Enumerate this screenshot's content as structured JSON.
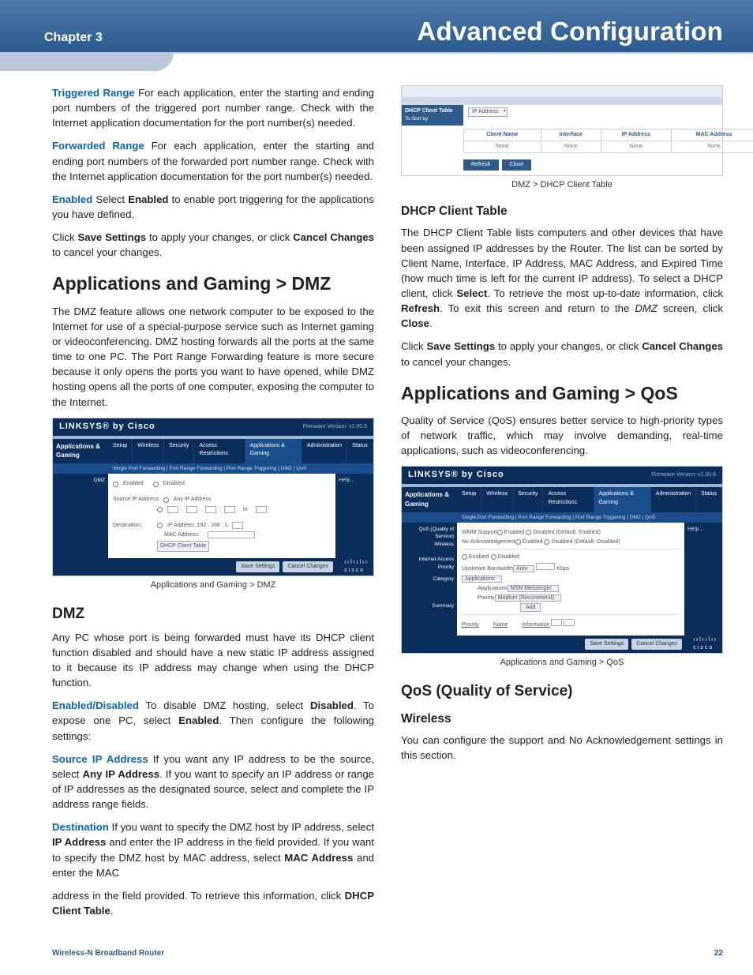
{
  "header": {
    "chapter": "Chapter 3",
    "title": "Advanced Configuration"
  },
  "left": {
    "triggered_label": "Triggered Range",
    "triggered_text": "  For each application, enter the starting and ending port numbers of the triggered port number range. Check with the Internet application documentation for the port number(s) needed.",
    "forwarded_label": "Forwarded Range",
    "forwarded_text": "  For each application, enter the starting and ending port numbers of the forwarded port number range. Check with the Internet application documentation for the port number(s) needed.",
    "enabled_label": "Enabled",
    "enabled_pre": "  Select ",
    "enabled_bold": "Enabled",
    "enabled_post": " to enable port triggering for the applications you have defined.",
    "save1_pre": "Click ",
    "save1_b1": "Save Settings",
    "save1_mid": " to apply your changes, or click ",
    "save1_b2": "Cancel Changes",
    "save1_post": " to cancel your changes.",
    "h_dmz": "Applications and Gaming > DMZ",
    "dmz_para": "The DMZ feature allows one network computer to be exposed to the Internet for use of a special-purpose service such as Internet gaming or videoconferencing. DMZ hosting forwards all the ports at the same time to one PC. The Port Range Forwarding feature is more secure because it only opens the ports you want to have opened, while DMZ hosting opens all the ports of one computer, exposing the computer to the Internet.",
    "fig1_caption": "Applications and Gaming > DMZ",
    "h_dmz2": "DMZ",
    "dmz2_para": "Any PC whose port is being forwarded must have its DHCP client function disabled and should have a new static IP address assigned to it because its IP address may change when using the DHCP function.",
    "ed_label": "Enabled/Disabled",
    "ed_pre": " To disable DMZ hosting, select ",
    "ed_b1": "Disabled",
    "ed_mid": ". To expose one PC, select ",
    "ed_b2": "Enabled",
    "ed_post": ". Then configure the following settings:",
    "src_label": "Source IP Address",
    "src_pre": "  If you want any IP address to be the source, select ",
    "src_b1": "Any IP Address",
    "src_post": ". If you want to specify an IP address or range of IP addresses as the designated source, select and complete the IP address range fields.",
    "dest_label": "Destination",
    "dest_pre": "  If you want to specify the DMZ host by IP address, select ",
    "dest_b1": "IP Address",
    "dest_mid": " and enter the IP address in the field provided. If you want to specify the DMZ host by MAC address, select ",
    "dest_b2": "MAC Address",
    "dest_post": " and enter the MAC "
  },
  "right": {
    "carry_pre": "address in the field provided. To retrieve this information, click ",
    "carry_b": "DHCP Client Table",
    "carry_post": ".",
    "fig2_caption": "DMZ > DHCP Client Table",
    "h_dhcp": "DHCP Client Table",
    "dhcp_pre": "The DHCP Client Table lists computers and other devices that have been assigned IP addresses by the Router. The list can be sorted by Client Name, Interface, IP Address, MAC Address, and Expired Time (how much time is left for the current IP address). To select a DHCP client, click ",
    "dhcp_b1": "Select",
    "dhcp_mid1": ". To retrieve the most up-to-date information, click ",
    "dhcp_b2": "Refresh",
    "dhcp_mid2": ". To exit this screen and return to the ",
    "dhcp_i": "DMZ",
    "dhcp_mid3": " screen, click ",
    "dhcp_b3": "Close",
    "dhcp_post": ".",
    "save2_pre": "Click ",
    "save2_b1": "Save Settings",
    "save2_mid": " to apply your changes, or click ",
    "save2_b2": "Cancel Changes",
    "save2_post": " to cancel your changes.",
    "h_qos": "Applications and Gaming > QoS",
    "qos_para": "Quality of Service (QoS) ensures better service to high-priority types of network traffic, which may involve demanding, real-time applications, such as videoconferencing.",
    "fig3_caption": "Applications and Gaming > QoS",
    "h_qos2": "QoS (Quality of Service)",
    "h_wireless": "Wireless",
    "wireless_para": "You can configure the support and No Acknowledgement settings in this section."
  },
  "router": {
    "brand": "LINKSYS® by Cisco",
    "fw": "Firmware Version: v1.00.6",
    "side": "Applications & Gaming",
    "tabs": [
      "Setup",
      "Wireless",
      "Security",
      "Access Restrictions",
      "Applications & Gaming",
      "Administration",
      "Status"
    ],
    "subnav_dmz": "Single Port Forwarding   |   Port Range Forwarding   |   Port Range Triggering   |   DMZ   |   QoS",
    "help": "Help...",
    "save": "Save Settings",
    "cancel": "Cancel Changes",
    "logo": "cisco",
    "dmz_side": "DMZ",
    "dmz_enabled": "Enabled",
    "dmz_disabled": "Disabled",
    "dmz_src": "Source IP Address:",
    "dmz_any": "Any IP Address",
    "dmz_to": "to",
    "dmz_dest": "Destination:",
    "dmz_ip": "IP Address: 192 . 168 . 1.",
    "dmz_mac": "MAC Address:",
    "dmz_btn": "DHCP Client Table",
    "qos_side1": "QoS (Quality of Service)",
    "qos_side2": "Wireless",
    "qos_side3": "Internet Access Priority",
    "qos_side4": "Category",
    "qos_side5": "Summary",
    "qos_wmm": "WMM Support",
    "qos_noack": "No Acknowledgement",
    "qos_en": "Enabled",
    "qos_dis": "Disabled (Default: Enabled)",
    "qos_dis2": "Disabled (Default: Disabled)",
    "qos_up": "Upstream Bandwidth",
    "qos_auto": "Auto",
    "qos_kbps": "Kbps",
    "qos_cat": "Applications",
    "qos_app": "Applications",
    "qos_msn": "MSN Messenger",
    "qos_pri": "Priority",
    "qos_med": "Medium (Recommend)",
    "qos_add": "Add",
    "qos_sum_pri": "Priority",
    "qos_sum_name": "Name",
    "qos_sum_info": "Information"
  },
  "dhcp": {
    "title": "DHCP Client Table",
    "sortby": "To Sort by",
    "sortval": "IP Address",
    "th": [
      "Client Name",
      "Interface",
      "IP Address",
      "MAC Address",
      ""
    ],
    "td": [
      "None",
      "None",
      "None",
      "None",
      ""
    ],
    "refresh": "Refresh",
    "close": "Close"
  },
  "footer": {
    "left": "Wireless-N Broadband Router",
    "right": "22"
  }
}
